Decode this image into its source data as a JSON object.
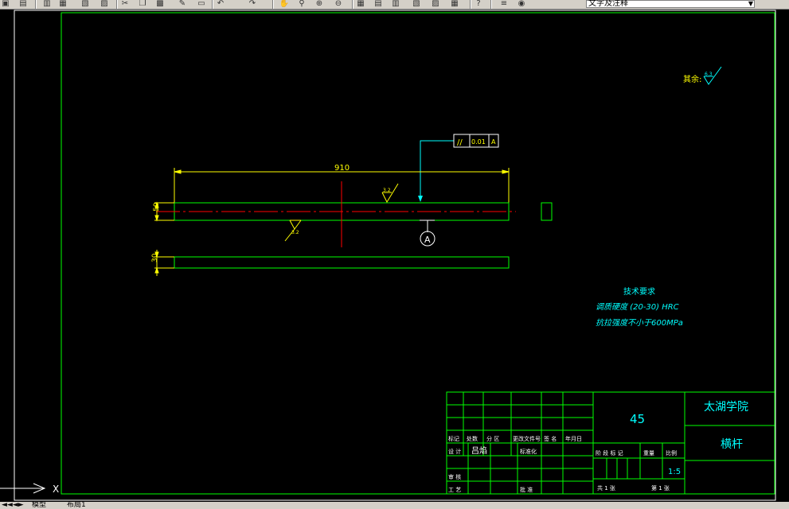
{
  "toolbar": {
    "layer_name": "文字及注释",
    "icons": [
      "new-icon",
      "save-icon",
      "print-icon",
      "preview-icon",
      "publish-icon",
      "plot-icon",
      "cut-icon",
      "copy-icon",
      "paste-icon",
      "match-properties-icon",
      "block-editor-icon",
      "undo-icon",
      "redo-icon",
      "pan-icon",
      "zoom-realtime-icon",
      "zoom-window-icon",
      "zoom-previous-icon",
      "properties-icon",
      "design-center-icon",
      "tool-palettes-icon",
      "sheet-set-icon",
      "markup-icon",
      "quickcalc-icon",
      "help-icon",
      "layer-manager-icon",
      "layer-state-icon"
    ]
  },
  "drawing": {
    "dimension_length": "910",
    "dimension_height_1": "50",
    "dimension_height_2": "30",
    "tolerance_symbol": "//",
    "tolerance_value": "0.01",
    "datum_letter": "A",
    "datum_label": "A",
    "roughness_value": "3.2",
    "roughness_value_2": "3.2",
    "other_roughness_label": "其余:",
    "other_roughness_value": "6.3",
    "tech_requirements": {
      "title": "技术要求",
      "line1": "调质硬度 (20-30) HRC",
      "line2": "抗拉强度不小于600MPa"
    }
  },
  "title_block": {
    "material": "45",
    "school": "太湖学院",
    "part_name": "横杆",
    "scale": "1:5",
    "labels": {
      "mark": "标记",
      "count": "处数",
      "zone": "分 区",
      "change_doc": "更改文件号",
      "signature": "签 名",
      "date": "年月日",
      "design": "设 计",
      "designer": "吕焰",
      "standardize": "标准化",
      "stage_mark": "阶 段 标 记",
      "weight": "重量",
      "scale_label": "比例",
      "review": "审 核",
      "process": "工 艺",
      "approve": "批 准",
      "total_sheets": "共 1 张",
      "sheet_no": "第 1 张"
    }
  },
  "bottom_tabs": {
    "model": "模型",
    "layout1": "布局1"
  },
  "ucs_label": "X"
}
